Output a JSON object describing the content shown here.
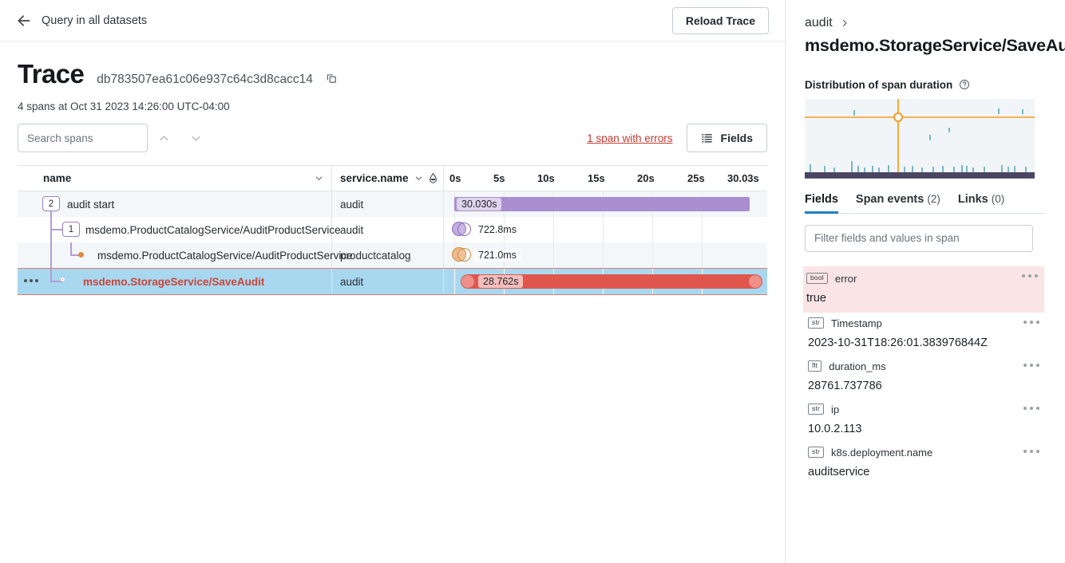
{
  "topbar": {
    "back_label": "Query in all datasets",
    "back_icon": "arrow-left-icon",
    "reload_label": "Reload Trace"
  },
  "trace": {
    "title": "Trace",
    "id": "db783507ea61c06e937c64c3d8cacc14",
    "copy_icon": "copy-icon",
    "meta": "4 spans at Oct 31 2023 14:26:00 UTC-04:00",
    "search_placeholder": "Search spans",
    "search_value": "",
    "prev_icon": "chevron-up-icon",
    "next_icon": "chevron-down-icon",
    "errors_link": "1 span with errors",
    "fields_button": "Fields",
    "fields_icon": "list-settings-icon"
  },
  "table": {
    "columns": {
      "name": "name",
      "service": "service.name"
    },
    "axis_ticks": [
      "0s",
      "5s",
      "10s",
      "15s",
      "20s",
      "25s",
      "30.03s"
    ],
    "total_duration_s": 30.03,
    "rows": [
      {
        "name": "audit start",
        "service": "audit",
        "duration_label": "30.030s",
        "badge": "2",
        "depth": 0,
        "kind": "bar",
        "color": "#a98fcf",
        "start_s": 0.0,
        "end_s": 30.03,
        "error": false,
        "selected": false
      },
      {
        "name": "msdemo.ProductCatalogService/AuditProductService",
        "service": "audit",
        "duration_label": "722.8ms",
        "badge": "1",
        "depth": 1,
        "kind": "mini",
        "color": "#a98fcf",
        "start_s": 0.0,
        "end_s": 0.7228,
        "error": false,
        "selected": false
      },
      {
        "name": "msdemo.ProductCatalogService/AuditProductService",
        "service": "productcatalog",
        "duration_label": "721.0ms",
        "badge": "",
        "depth": 2,
        "kind": "mini",
        "color": "#e0a15f",
        "start_s": 0.0,
        "end_s": 0.721,
        "error": false,
        "selected": false
      },
      {
        "name": "msdemo.StorageService/SaveAudit",
        "service": "audit",
        "duration_label": "28.762s",
        "badge": "",
        "depth": 1,
        "kind": "bar",
        "color": "#e0564c",
        "start_s": 0.7,
        "end_s": 29.7,
        "error": true,
        "selected": true
      }
    ]
  },
  "detail": {
    "breadcrumb_service": "audit",
    "breadcrumb_icon": "chevron-right-icon",
    "span_title": "msdemo.StorageService/SaveAudit",
    "distribution_label": "Distribution of span duration",
    "help_icon": "question-circle-icon",
    "tabs": [
      {
        "label": "Fields",
        "count": "",
        "active": true
      },
      {
        "label": "Span events",
        "count": "(2)",
        "active": false
      },
      {
        "label": "Links",
        "count": "(0)",
        "active": false
      }
    ],
    "filter_placeholder": "Filter fields and values in span",
    "filter_value": "",
    "fields": [
      {
        "type": "bool",
        "name": "error",
        "value": "true",
        "highlight": true
      },
      {
        "type": "str",
        "name": "Timestamp",
        "value": "2023-10-31T18:26:01.383976844Z",
        "highlight": false
      },
      {
        "type": "flt",
        "name": "duration_ms",
        "value": "28761.737786",
        "highlight": false
      },
      {
        "type": "str",
        "name": "ip",
        "value": "10.0.2.113",
        "highlight": false
      },
      {
        "type": "str",
        "name": "k8s.deployment.name",
        "value": "auditservice",
        "highlight": false
      }
    ]
  },
  "colors": {
    "accent": "#1f7fc4",
    "error": "#cc4437",
    "purple_span": "#a98fcf",
    "orange_span": "#e0a15f",
    "selected_row": "#a8d8f0",
    "crosshair": "#f5a83c"
  },
  "chart_data": {
    "type": "scatter",
    "title": "Distribution of span duration",
    "xlabel": "",
    "ylabel": "",
    "grid": false,
    "legend": null,
    "crosshair": {
      "x_fraction": 0.4,
      "y_fraction": 0.22,
      "color": "#f5a83c"
    },
    "points_x_fractions": [
      0.02,
      0.08,
      0.2,
      0.25,
      0.3,
      0.33,
      0.4,
      0.44,
      0.47,
      0.52,
      0.58,
      0.62,
      0.66,
      0.7,
      0.74,
      0.78,
      0.84,
      0.88,
      0.92,
      0.96
    ],
    "points_y_fractions": [
      0.93,
      0.93,
      0.9,
      0.75,
      0.92,
      0.93,
      0.93,
      0.9,
      0.93,
      0.92,
      0.93,
      0.9,
      0.93,
      0.93,
      0.92,
      0.93,
      0.93,
      0.9,
      0.93,
      0.92
    ],
    "baseline_color": "#4a4562",
    "note": "dense low-duration cluster along baseline with sparse high outliers"
  }
}
